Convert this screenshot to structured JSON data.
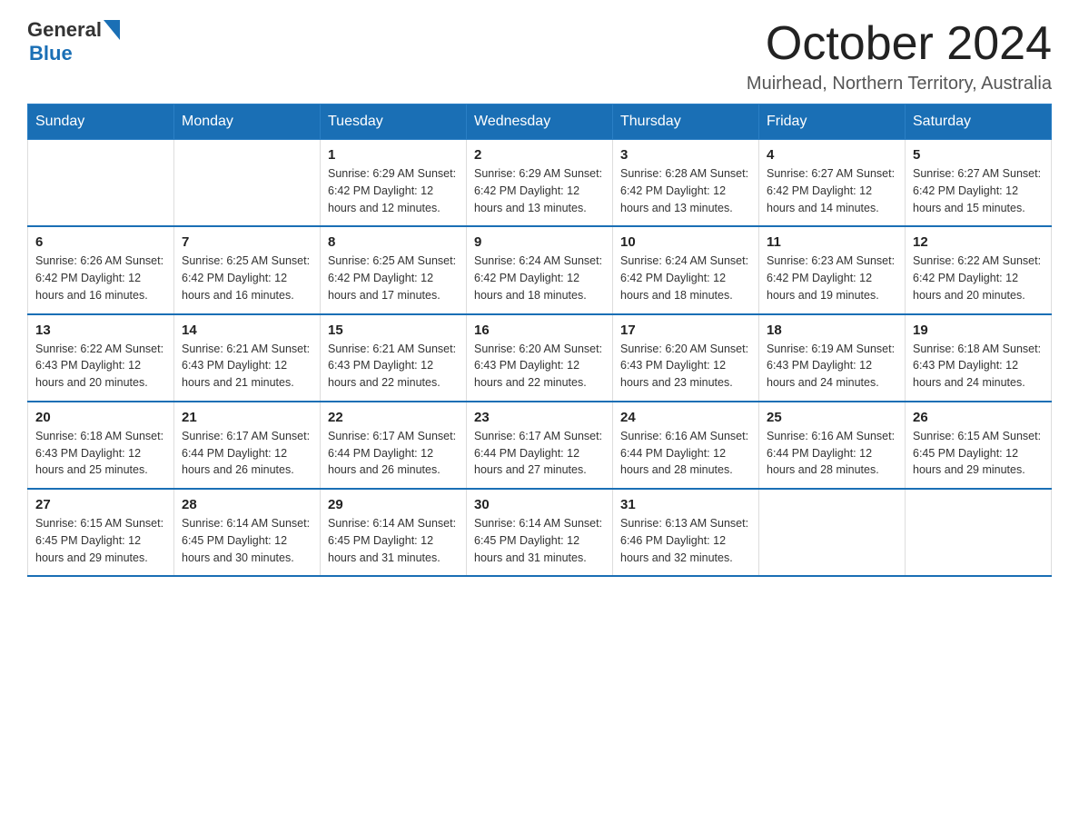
{
  "header": {
    "logo_general": "General",
    "logo_blue": "Blue",
    "month_title": "October 2024",
    "location": "Muirhead, Northern Territory, Australia"
  },
  "days_of_week": [
    "Sunday",
    "Monday",
    "Tuesday",
    "Wednesday",
    "Thursday",
    "Friday",
    "Saturday"
  ],
  "weeks": [
    [
      {
        "day": "",
        "details": ""
      },
      {
        "day": "",
        "details": ""
      },
      {
        "day": "1",
        "details": "Sunrise: 6:29 AM\nSunset: 6:42 PM\nDaylight: 12 hours\nand 12 minutes."
      },
      {
        "day": "2",
        "details": "Sunrise: 6:29 AM\nSunset: 6:42 PM\nDaylight: 12 hours\nand 13 minutes."
      },
      {
        "day": "3",
        "details": "Sunrise: 6:28 AM\nSunset: 6:42 PM\nDaylight: 12 hours\nand 13 minutes."
      },
      {
        "day": "4",
        "details": "Sunrise: 6:27 AM\nSunset: 6:42 PM\nDaylight: 12 hours\nand 14 minutes."
      },
      {
        "day": "5",
        "details": "Sunrise: 6:27 AM\nSunset: 6:42 PM\nDaylight: 12 hours\nand 15 minutes."
      }
    ],
    [
      {
        "day": "6",
        "details": "Sunrise: 6:26 AM\nSunset: 6:42 PM\nDaylight: 12 hours\nand 16 minutes."
      },
      {
        "day": "7",
        "details": "Sunrise: 6:25 AM\nSunset: 6:42 PM\nDaylight: 12 hours\nand 16 minutes."
      },
      {
        "day": "8",
        "details": "Sunrise: 6:25 AM\nSunset: 6:42 PM\nDaylight: 12 hours\nand 17 minutes."
      },
      {
        "day": "9",
        "details": "Sunrise: 6:24 AM\nSunset: 6:42 PM\nDaylight: 12 hours\nand 18 minutes."
      },
      {
        "day": "10",
        "details": "Sunrise: 6:24 AM\nSunset: 6:42 PM\nDaylight: 12 hours\nand 18 minutes."
      },
      {
        "day": "11",
        "details": "Sunrise: 6:23 AM\nSunset: 6:42 PM\nDaylight: 12 hours\nand 19 minutes."
      },
      {
        "day": "12",
        "details": "Sunrise: 6:22 AM\nSunset: 6:42 PM\nDaylight: 12 hours\nand 20 minutes."
      }
    ],
    [
      {
        "day": "13",
        "details": "Sunrise: 6:22 AM\nSunset: 6:43 PM\nDaylight: 12 hours\nand 20 minutes."
      },
      {
        "day": "14",
        "details": "Sunrise: 6:21 AM\nSunset: 6:43 PM\nDaylight: 12 hours\nand 21 minutes."
      },
      {
        "day": "15",
        "details": "Sunrise: 6:21 AM\nSunset: 6:43 PM\nDaylight: 12 hours\nand 22 minutes."
      },
      {
        "day": "16",
        "details": "Sunrise: 6:20 AM\nSunset: 6:43 PM\nDaylight: 12 hours\nand 22 minutes."
      },
      {
        "day": "17",
        "details": "Sunrise: 6:20 AM\nSunset: 6:43 PM\nDaylight: 12 hours\nand 23 minutes."
      },
      {
        "day": "18",
        "details": "Sunrise: 6:19 AM\nSunset: 6:43 PM\nDaylight: 12 hours\nand 24 minutes."
      },
      {
        "day": "19",
        "details": "Sunrise: 6:18 AM\nSunset: 6:43 PM\nDaylight: 12 hours\nand 24 minutes."
      }
    ],
    [
      {
        "day": "20",
        "details": "Sunrise: 6:18 AM\nSunset: 6:43 PM\nDaylight: 12 hours\nand 25 minutes."
      },
      {
        "day": "21",
        "details": "Sunrise: 6:17 AM\nSunset: 6:44 PM\nDaylight: 12 hours\nand 26 minutes."
      },
      {
        "day": "22",
        "details": "Sunrise: 6:17 AM\nSunset: 6:44 PM\nDaylight: 12 hours\nand 26 minutes."
      },
      {
        "day": "23",
        "details": "Sunrise: 6:17 AM\nSunset: 6:44 PM\nDaylight: 12 hours\nand 27 minutes."
      },
      {
        "day": "24",
        "details": "Sunrise: 6:16 AM\nSunset: 6:44 PM\nDaylight: 12 hours\nand 28 minutes."
      },
      {
        "day": "25",
        "details": "Sunrise: 6:16 AM\nSunset: 6:44 PM\nDaylight: 12 hours\nand 28 minutes."
      },
      {
        "day": "26",
        "details": "Sunrise: 6:15 AM\nSunset: 6:45 PM\nDaylight: 12 hours\nand 29 minutes."
      }
    ],
    [
      {
        "day": "27",
        "details": "Sunrise: 6:15 AM\nSunset: 6:45 PM\nDaylight: 12 hours\nand 29 minutes."
      },
      {
        "day": "28",
        "details": "Sunrise: 6:14 AM\nSunset: 6:45 PM\nDaylight: 12 hours\nand 30 minutes."
      },
      {
        "day": "29",
        "details": "Sunrise: 6:14 AM\nSunset: 6:45 PM\nDaylight: 12 hours\nand 31 minutes."
      },
      {
        "day": "30",
        "details": "Sunrise: 6:14 AM\nSunset: 6:45 PM\nDaylight: 12 hours\nand 31 minutes."
      },
      {
        "day": "31",
        "details": "Sunrise: 6:13 AM\nSunset: 6:46 PM\nDaylight: 12 hours\nand 32 minutes."
      },
      {
        "day": "",
        "details": ""
      },
      {
        "day": "",
        "details": ""
      }
    ]
  ]
}
